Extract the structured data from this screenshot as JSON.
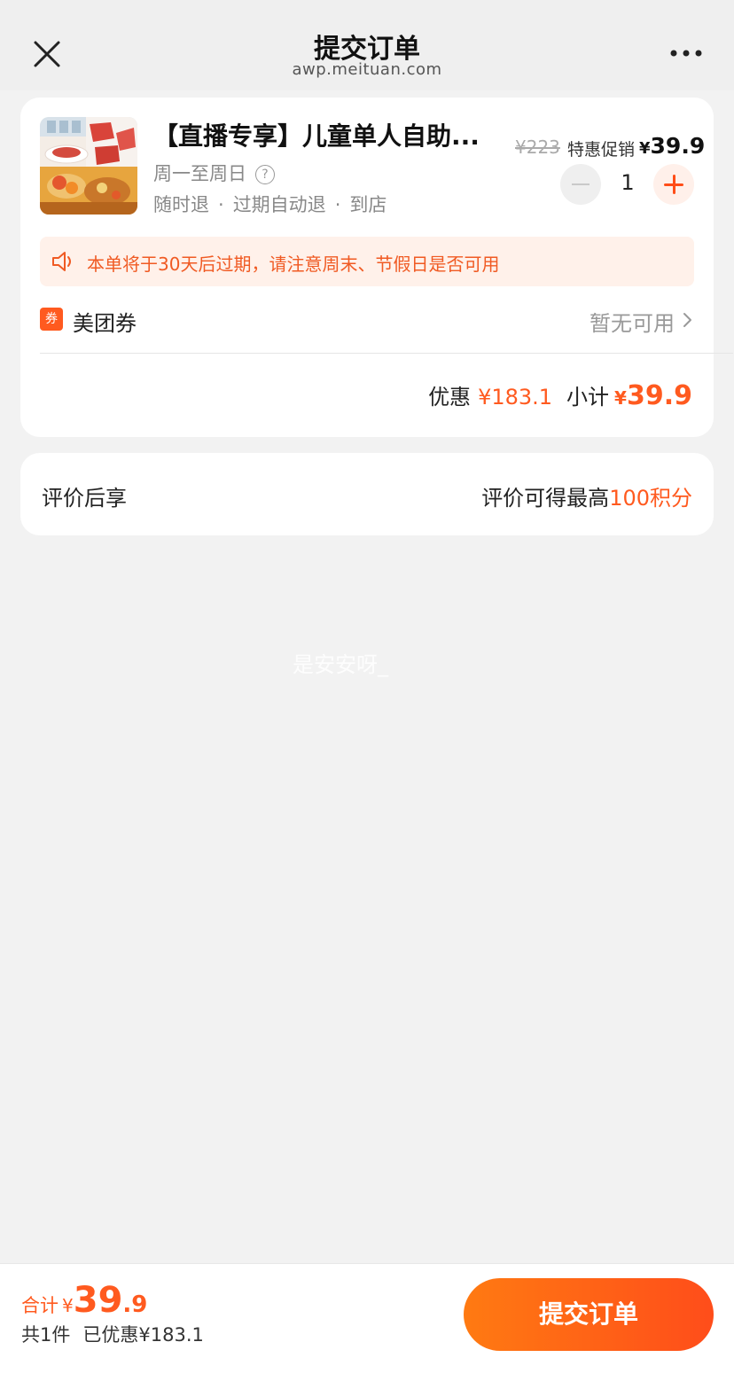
{
  "header": {
    "title": "提交订单",
    "url": "awp.meituan.com"
  },
  "product": {
    "title": "【直播专享】儿童单人自助...",
    "days": "周一至周日",
    "tags": [
      "随时退",
      "过期自动退",
      "到店"
    ],
    "original_price": "¥223",
    "promo_label": "特惠促销",
    "price_symbol": "¥",
    "price_value": "39.9",
    "quantity": "1"
  },
  "notice": {
    "text": "本单将于30天后过期，请注意周末、节假日是否可用"
  },
  "coupon": {
    "badge": "券",
    "label": "美团券",
    "value": "暂无可用"
  },
  "summary": {
    "discount_label": "优惠",
    "discount_value": "¥183.1",
    "subtotal_label": "小计",
    "subtotal_symbol": "¥",
    "subtotal_value": "39.9"
  },
  "review": {
    "left": "评价后享",
    "right_prefix": "评价可得最高",
    "right_points": "100积分"
  },
  "watermark": "是安安呀_",
  "bottom": {
    "total_label": "合计",
    "total_symbol": "¥",
    "total_int": "39",
    "total_dec": ".9",
    "count": "共1件",
    "saved": "已优惠¥183.1",
    "submit": "提交订单"
  },
  "colors": {
    "accent": "#ff5a1f",
    "notice_bg": "#fff1ea",
    "page_bg": "#f2f2f2"
  }
}
